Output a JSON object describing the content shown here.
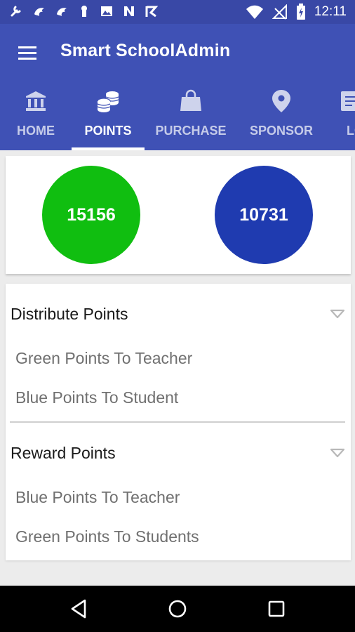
{
  "status_bar": {
    "time": "12:11",
    "left_icons": [
      "tool-icon",
      "bird-icon",
      "bird-icon",
      "keyhole-icon",
      "image-icon",
      "n-icon",
      "check-flag-icon"
    ],
    "right_icons": [
      "wifi-icon",
      "signal-off-icon",
      "battery-charging-icon"
    ]
  },
  "app_bar": {
    "title": "Smart SchoolAdmin",
    "menu_icon": "hamburger-menu-icon"
  },
  "tabs": [
    {
      "label": "HOME",
      "icon": "bank-icon",
      "active": false
    },
    {
      "label": "POINTS",
      "icon": "coins-icon",
      "active": true
    },
    {
      "label": "PURCHASE",
      "icon": "shopping-bag-icon",
      "active": false
    },
    {
      "label": "SPONSOR",
      "icon": "location-pin-icon",
      "active": false
    },
    {
      "label": "LO",
      "icon": "document-icon",
      "active": false
    }
  ],
  "points": {
    "green": {
      "value": "15156",
      "color": "#10be10"
    },
    "blue": {
      "value": "10731",
      "color": "#1f3bb0"
    }
  },
  "distribute": {
    "title": "Distribute Points",
    "items": [
      "Green Points To Teacher",
      "Blue Points To Student"
    ]
  },
  "reward": {
    "title": "Reward Points",
    "items": [
      "Blue Points To Teacher",
      "Green Points To Students"
    ]
  },
  "colors": {
    "primary": "#3f51b5",
    "primary_dark": "#3948a6",
    "background": "#ececec"
  },
  "nav_bar": {
    "buttons": [
      "back-triangle-icon",
      "home-circle-icon",
      "recents-square-icon"
    ]
  }
}
